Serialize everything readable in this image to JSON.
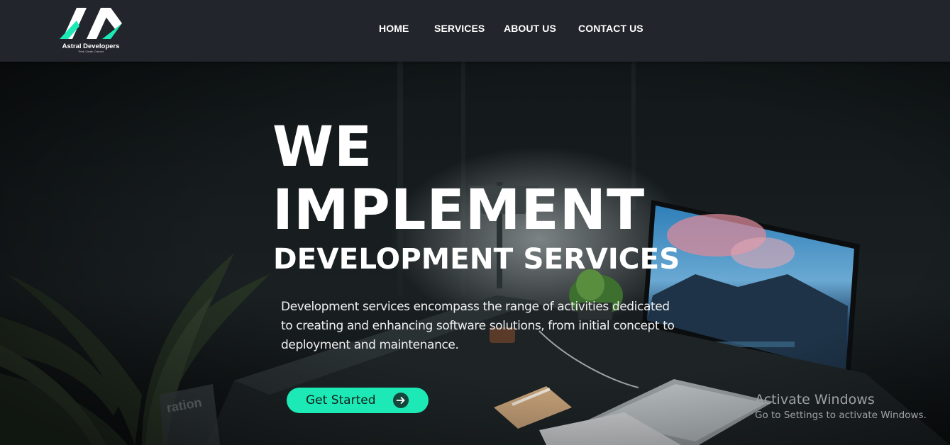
{
  "header": {
    "logo": {
      "name": "Astral Developers",
      "tagline": "Think, Create, Connect"
    },
    "nav": [
      {
        "label": "HOME"
      },
      {
        "label": "SERVICES"
      },
      {
        "label": "ABOUT US"
      },
      {
        "label": "CONTACT US"
      }
    ]
  },
  "hero": {
    "title_line1": "WE",
    "title_line2": "IMPLEMENT",
    "subtitle": "DEVELOPMENT SERVICES",
    "description": "Development services encompass the range of activities dedicated to creating and enhancing software solutions, from initial concept to deployment and maintenance.",
    "cta": {
      "label": "Get Started",
      "icon": "arrow-right-circle-icon"
    },
    "background_image": "dark desk workspace with monitor, laptop, notebook and plants"
  },
  "watermark": {
    "title": "Activate Windows",
    "subtitle": "Go to Settings to activate Windows."
  },
  "colors": {
    "header_bg": "#22252b",
    "accent": "#1de9b6",
    "text": "#ffffff"
  }
}
